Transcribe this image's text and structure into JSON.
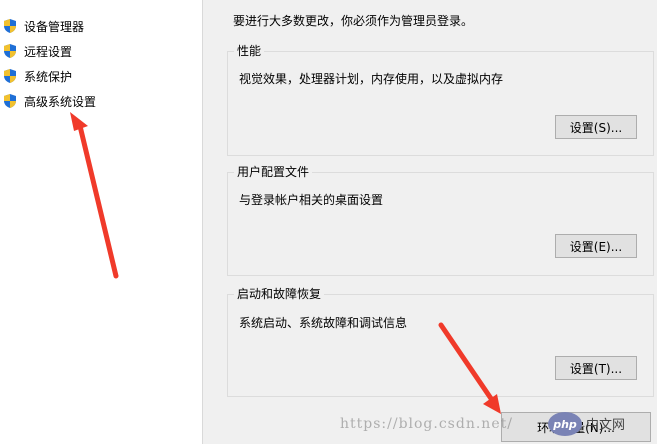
{
  "sidebar": {
    "items": [
      {
        "label": "设备管理器",
        "icon": "shield-icon"
      },
      {
        "label": "远程设置",
        "icon": "shield-icon"
      },
      {
        "label": "系统保护",
        "icon": "shield-icon"
      },
      {
        "label": "高级系统设置",
        "icon": "shield-icon"
      }
    ]
  },
  "main": {
    "admin_note": "要进行大多数更改，你必须作为管理员登录。",
    "groups": [
      {
        "title": "性能",
        "description": "视觉效果，处理器计划，内存使用，以及虚拟内存",
        "button": "设置(S)..."
      },
      {
        "title": "用户配置文件",
        "description": "与登录帐户相关的桌面设置",
        "button": "设置(E)..."
      },
      {
        "title": "启动和故障恢复",
        "description": "系统启动、系统故障和调试信息",
        "button": "设置(T)..."
      }
    ],
    "env_button": "环境变量(N)..."
  },
  "overlay": {
    "watermark": "https://blog.csdn.net/",
    "logo_text": "php",
    "logo_caption": "中文网"
  },
  "colors": {
    "pane_bg": "#f0f0f0",
    "button_bg": "#e1e1e1",
    "button_border": "#adadad",
    "annotation_arrow": "#f03a2a",
    "shield_blue": "#1f6fd6",
    "shield_yellow": "#f2c12e"
  }
}
